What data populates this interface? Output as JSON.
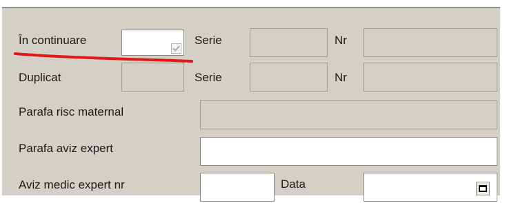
{
  "form": {
    "in_continuare": {
      "label": "În continuare",
      "checked": true
    },
    "duplicat": {
      "label": "Duplicat"
    },
    "serie_label": "Serie",
    "nr_label": "Nr",
    "parafa_risc_matern": {
      "label": "Parafa risc maternal"
    },
    "parafa_aviz_expert": {
      "label": "Parafa aviz expert"
    },
    "aviz_medic_expert_nr": {
      "label": "Aviz medic expert nr"
    },
    "data": {
      "label": "Data"
    }
  },
  "annotation": {
    "underline_color": "#e01818"
  }
}
